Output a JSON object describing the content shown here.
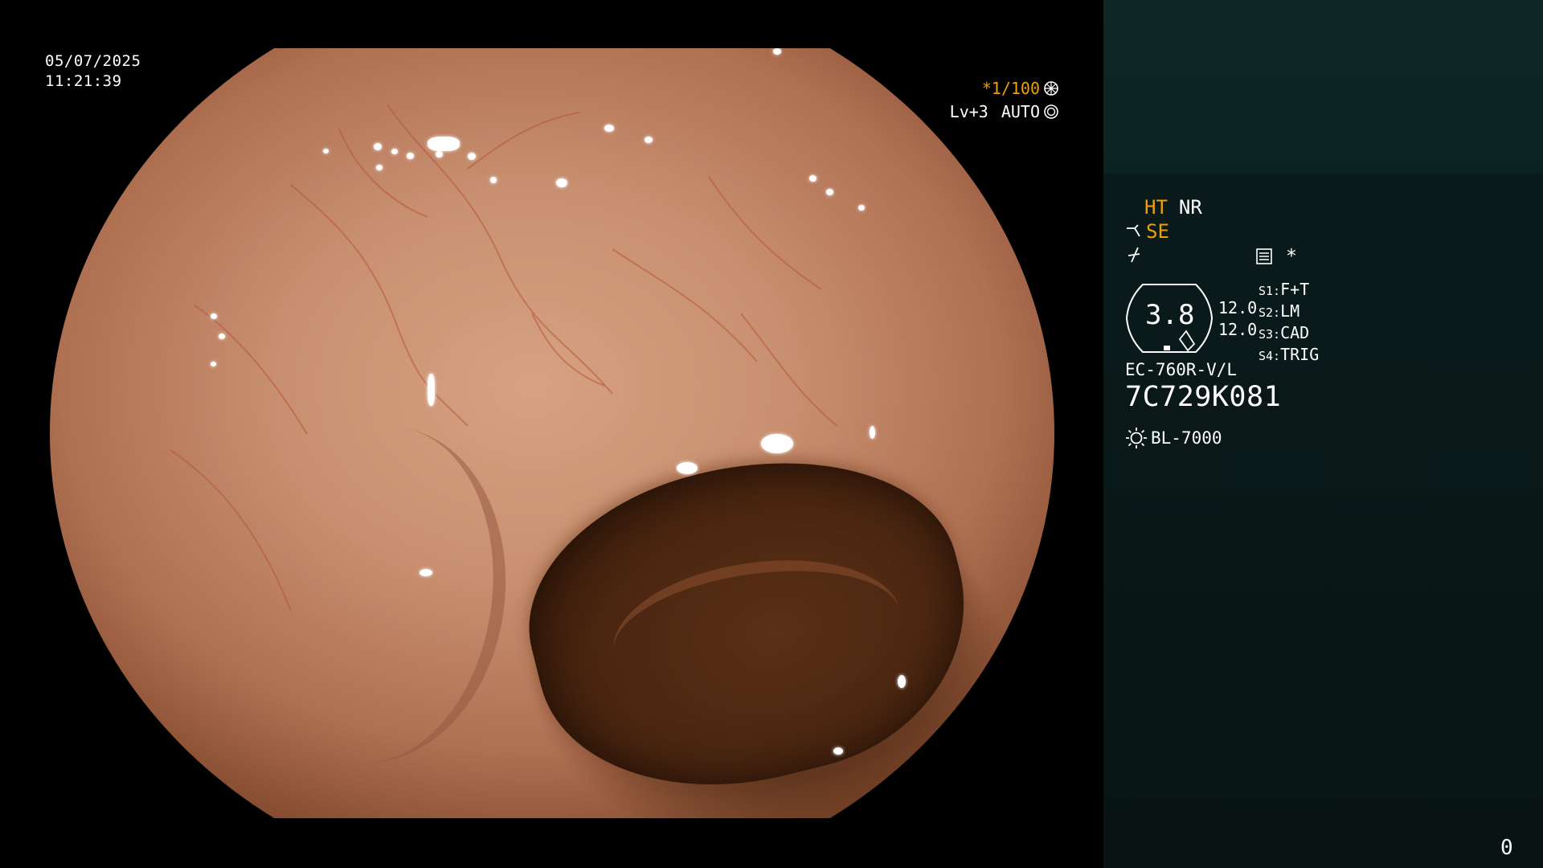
{
  "overlay": {
    "date": "05/07/2025",
    "time": "11:21:39",
    "shutter": "*1/100",
    "level": "Lv+3",
    "mode": "AUTO"
  },
  "panel": {
    "ht": "HT",
    "nr": "NR",
    "se": "SE",
    "asterisk": "*",
    "gauge_value": "3.8",
    "value1": "12.0",
    "value2": "12.0",
    "switches": [
      {
        "key": "S1:",
        "label": "F+T"
      },
      {
        "key": "S2:",
        "label": "LM"
      },
      {
        "key": "S3:",
        "label": "CAD"
      },
      {
        "key": "S4:",
        "label": "TRIG"
      }
    ],
    "scope_model": "EC-760R-V/L",
    "serial": "7C729K081",
    "light_source": "BL-7000",
    "counter": "0"
  },
  "colors": {
    "accent": "#f0a000",
    "panel_bg": "#081414",
    "panel_top_bg": "#0b2323"
  },
  "icons": [
    "shutter-dial-icon",
    "auto-iris-icon",
    "scissors-icon",
    "switch-icon",
    "menu-list-icon",
    "lamp-icon"
  ]
}
